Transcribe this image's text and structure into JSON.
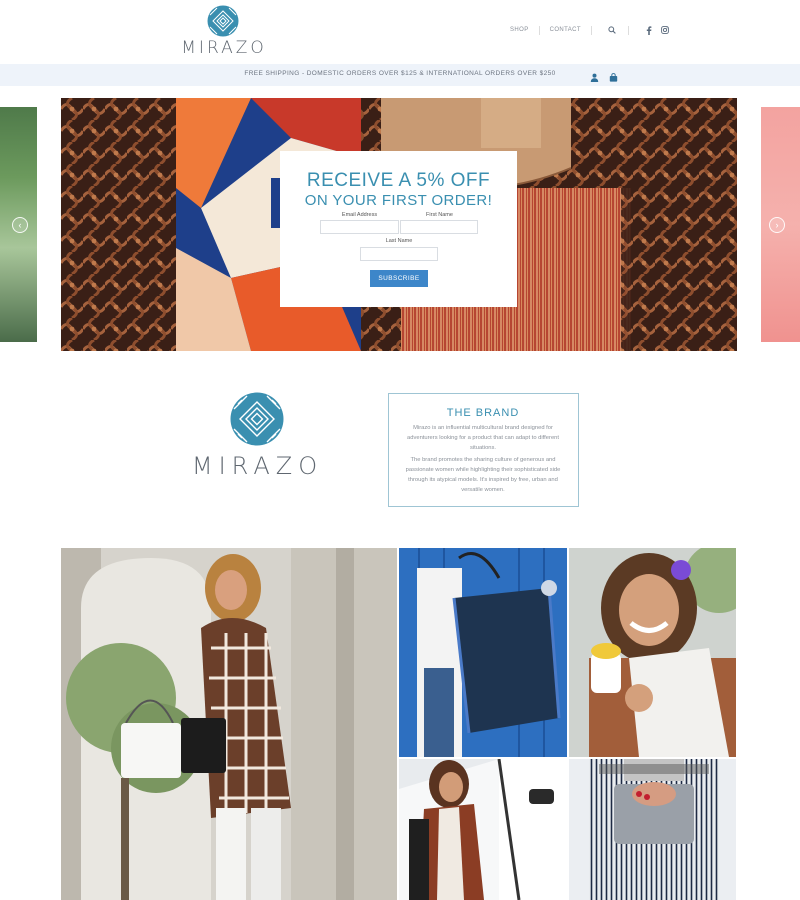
{
  "header": {
    "logo_text": "MIRAZO",
    "nav": [
      "SHOP",
      "CONTACT"
    ],
    "icons": [
      "search-icon",
      "facebook-icon",
      "instagram-icon"
    ]
  },
  "shipping_bar": {
    "text": "FREE SHIPPING - DOMESTIC ORDERS OVER $125 & INTERNATIONAL ORDERS OVER $250",
    "icons": [
      "user-icon",
      "cart-icon"
    ]
  },
  "popup": {
    "title_line1": "RECEIVE A 5% OFF",
    "title_line2": "ON YOUR FIRST ORDER!",
    "email_label": "Email Address",
    "first_name_label": "First Name",
    "last_name_label": "Last Name",
    "email_value": "",
    "first_name_value": "",
    "last_name_value": "",
    "subscribe_label": "SUBSCRIBE"
  },
  "brand": {
    "logo_text": "MIRAZO",
    "title": "THE BRAND",
    "paragraph1": "Mirazo is an influential multicultural brand designed for adventurers looking for a product that can adapt to different situations.",
    "paragraph2": "The brand promotes the sharing culture of generous and passionate women while highlighting their sophisticated side through its atypical models. It's inspired by free, urban and versatile women."
  },
  "colors": {
    "accent": "#3a8fb0",
    "button": "#3d86c9",
    "shipbar_bg": "#eef3fa"
  }
}
